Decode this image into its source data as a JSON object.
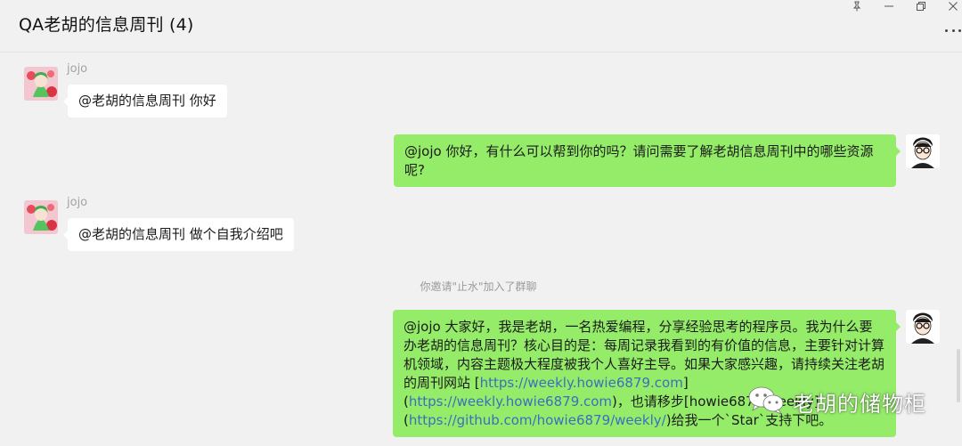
{
  "window": {
    "title": "QA老胡的信息周刊 (4)",
    "controls": [
      "pin-icon",
      "minimize-icon",
      "restore-icon",
      "close-icon"
    ],
    "more_icon": "more-icon"
  },
  "messages": [
    {
      "side": "left",
      "sender": "jojo",
      "text": "@老胡的信息周刊 你好"
    },
    {
      "side": "right",
      "text": "@jojo 你好，有什么可以帮到你的吗？请问需要了解老胡信息周刊中的哪些资源呢?"
    },
    {
      "side": "left",
      "sender": "jojo",
      "text": "@老胡的信息周刊 做个自我介绍吧"
    },
    {
      "side": "system",
      "text": "你邀请\"止水\"加入了群聊"
    },
    {
      "side": "right",
      "parts": {
        "p1": "@jojo 大家好，我是老胡，一名热爱编程，分享经验思考的程序员。我为什么要办老胡的信息周刊？核心目的是：每周记录我看到的有价值的信息，主要针对计算机领域，内容主题极大程度被我个人喜好主导。如果大家感兴趣，请持续关注老胡的周刊网站 [",
        "link1": "https://weekly.howie6879.com",
        "p2": "](",
        "link2": "https://weekly.howie6879.com",
        "p3": ")，也请移步[howie6879/weekly](",
        "link3": "https://github.com/howie6879/weekly/",
        "p4": ")给我一个`Star`支持下吧。"
      }
    }
  ],
  "watermark": {
    "icon": "wechat-icon",
    "text": "老胡的储物柜"
  },
  "colors": {
    "background": "#f1f1f1",
    "self_bubble": "#95ec69",
    "other_bubble": "#ffffff",
    "link": "#3a6fbf"
  }
}
